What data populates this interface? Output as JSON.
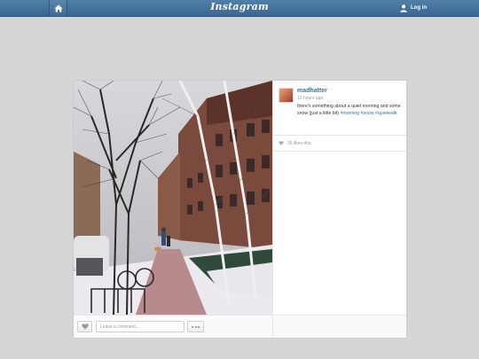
{
  "header": {
    "logo": "Instagram",
    "home_icon": "home-icon",
    "user_icon": "user-icon",
    "login_label": "Log in",
    "bar_color": "#3f6a93"
  },
  "post": {
    "username": "madhatter",
    "time_ago": "12 hours ago",
    "caption_text": "there's something about a quiet morning and some snow (just a little bit) ",
    "hashtags": [
      "#morning",
      "#snow",
      "#quietwalk"
    ],
    "likes_text": "35 likes this.",
    "heart_icon": "heart-icon",
    "comment_placeholder": "Leave a comment...",
    "more_icon": "ellipsis-icon",
    "link_color": "#3f729b"
  }
}
